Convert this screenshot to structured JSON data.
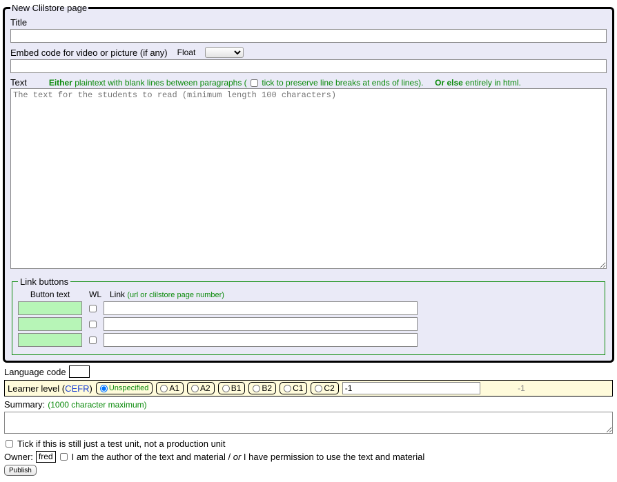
{
  "fieldset": {
    "legend": "New Clilstore page",
    "title_label": "Title",
    "title_value": "",
    "embed_label": "Embed code for video or picture (if any)",
    "float_label": "Float",
    "embed_value": "",
    "text_label": "Text",
    "hint_either": "Either",
    "hint_plaintext": " plaintext with blank lines between paragraphs ( ",
    "hint_tick": " tick to preserve line breaks at ends of lines).",
    "hint_orelse": "Or else",
    "hint_html": " entirely in html.",
    "text_placeholder": "The text for the students to read (minimum length 100 characters)"
  },
  "linkbuttons": {
    "legend": "Link buttons",
    "col_btn": "Button text",
    "col_wl": "WL",
    "col_link": "Link",
    "col_link_hint": "(url or clilstore page number)",
    "rows": [
      {
        "btn": "",
        "link": ""
      },
      {
        "btn": "",
        "link": ""
      },
      {
        "btn": "",
        "link": ""
      }
    ]
  },
  "langcode": {
    "label": "Language code",
    "value": ""
  },
  "cefr": {
    "label_prefix": "Learner level (",
    "label_link": "CEFR",
    "label_suffix": ")",
    "options": [
      "Unspecified",
      "A1",
      "A2",
      "B1",
      "B2",
      "C1",
      "C2"
    ],
    "selected": "Unspecified",
    "numeric": "-1",
    "numeric_display": "-1"
  },
  "summary": {
    "label": "Summary:",
    "hint": "(1000 character maximum)",
    "value": ""
  },
  "testunit": {
    "label": "Tick if this is still just a test unit, not a production unit"
  },
  "owner": {
    "label": "Owner:",
    "name": "fred",
    "perm_prefix": " I am the author of the text and material / ",
    "perm_or": "or",
    "perm_suffix": " I have permission to use the text and material"
  },
  "publish": {
    "label": "Publish"
  }
}
